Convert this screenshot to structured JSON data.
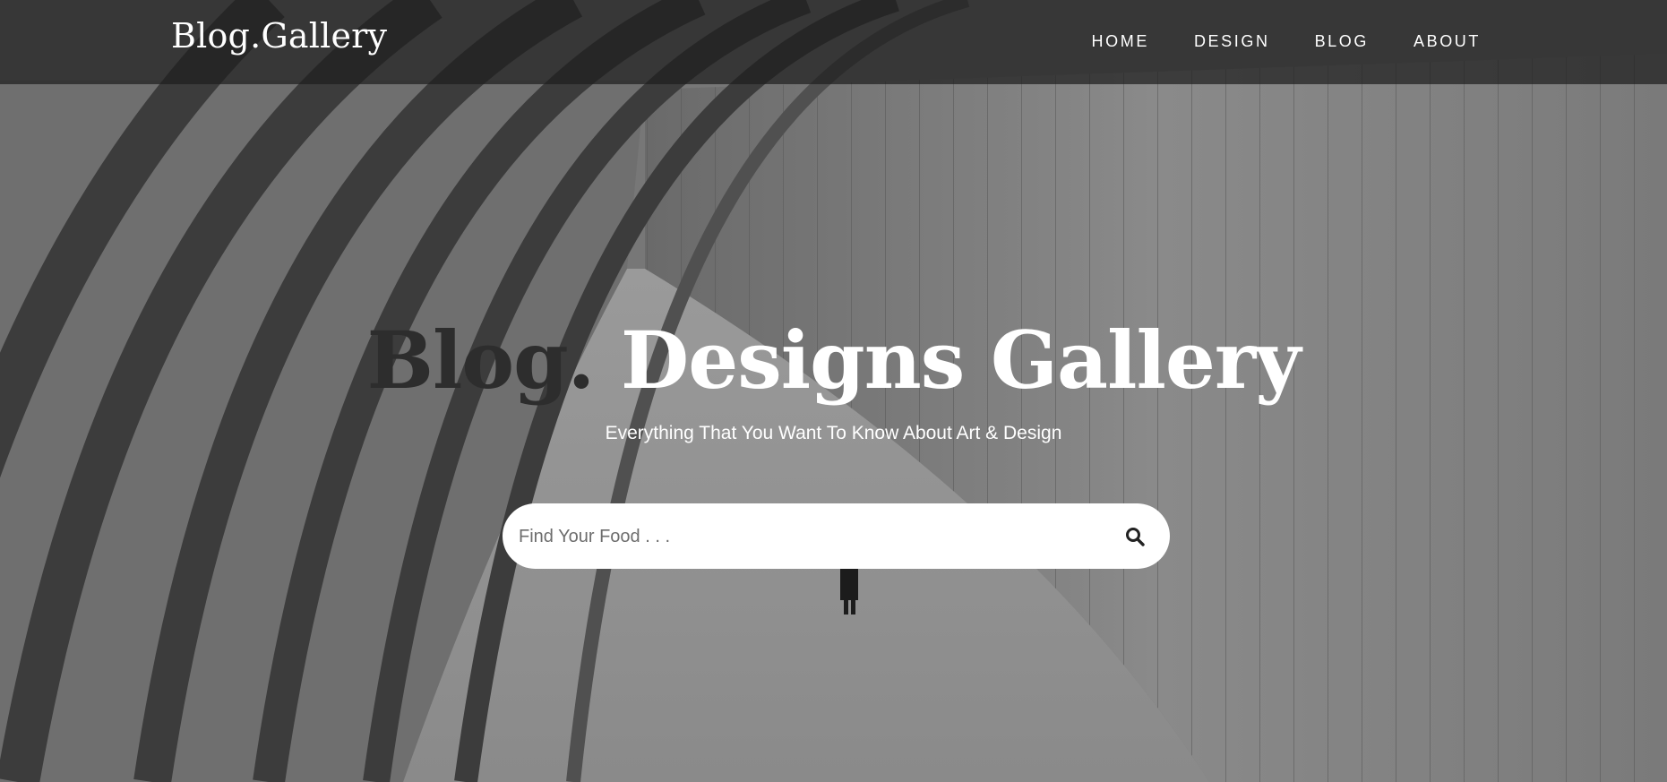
{
  "header": {
    "brand": "Blog.Gallery",
    "nav": [
      {
        "label": "HOME"
      },
      {
        "label": "DESIGN"
      },
      {
        "label": "BLOG"
      },
      {
        "label": "ABOUT"
      }
    ]
  },
  "hero": {
    "title_dark": "Blog.",
    "title_light": "Designs Gallery",
    "subtitle": "Everything That You Want To Know About Art & Design",
    "background": "grayscale-concrete-tunnel-photo"
  },
  "search": {
    "placeholder": "Find Your Food . . .",
    "value": "",
    "icon": "search-icon"
  },
  "colors": {
    "topbar": "#1e1e1e",
    "text": "#ffffff",
    "title_dark": "#2d2d2d",
    "search_bg": "#ffffff"
  }
}
